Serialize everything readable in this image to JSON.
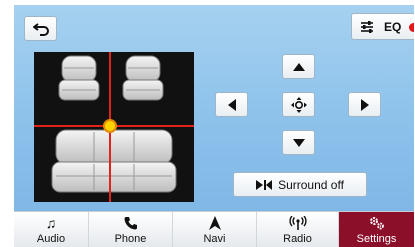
{
  "header": {
    "back_icon": "back-arrow-icon",
    "eq_icon": "equalizer-sliders-icon",
    "eq_label": "EQ",
    "eq_indicator_color": "#e31919"
  },
  "fader": {
    "accent_line_color": "#e2231a",
    "dot_color": "#ffd200"
  },
  "controls": {
    "up_icon": "up-arrow-icon",
    "down_icon": "down-arrow-icon",
    "left_icon": "left-arrow-icon",
    "right_icon": "right-arrow-icon",
    "center_icon": "center-reset-icon",
    "surround_icon": "surround-icon",
    "surround_label": "Surround off"
  },
  "nav": {
    "items": [
      {
        "label": "Audio",
        "icon": "music-note-icon",
        "active": false
      },
      {
        "label": "Phone",
        "icon": "phone-icon",
        "active": false
      },
      {
        "label": "Navi",
        "icon": "navigation-icon",
        "active": false
      },
      {
        "label": "Radio",
        "icon": "radio-antenna-icon",
        "active": false
      },
      {
        "label": "Settings",
        "icon": "gears-icon",
        "active": true
      }
    ],
    "active_color": "#8c0f2a"
  }
}
